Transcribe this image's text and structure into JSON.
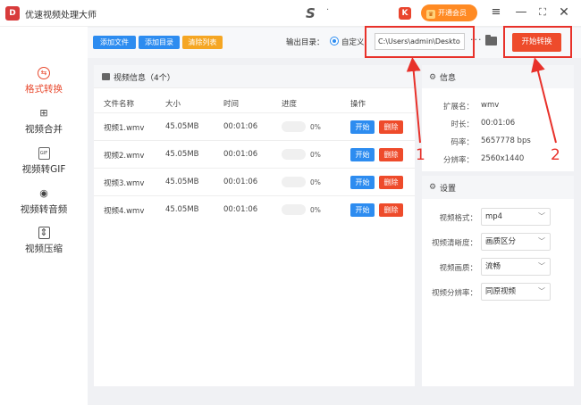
{
  "app": {
    "title": "优速视频处理大师",
    "logo_char": "D"
  },
  "titlebar": {
    "mid_logo": "S",
    "mid_dot": "·",
    "k_icon": "K",
    "vip_label": "开通会员",
    "vip_crown": "♛"
  },
  "sidebar": {
    "items": [
      {
        "label": "格式转换",
        "icon": "format-convert-icon",
        "glyph": "⇆",
        "active": true
      },
      {
        "label": "视频合并",
        "icon": "merge-icon",
        "glyph": "⊞"
      },
      {
        "label": "视频转GIF",
        "icon": "gif-icon",
        "glyph": "GIF"
      },
      {
        "label": "视频转音频",
        "icon": "audio-icon",
        "glyph": "◉"
      },
      {
        "label": "视频压缩",
        "icon": "compress-icon",
        "glyph": "⇕"
      }
    ]
  },
  "toolbar": {
    "add_file": "添加文件",
    "add_dir": "添加目录",
    "clear_list": "清除列表",
    "output_label": "输出目录：",
    "custom_label": "自定义",
    "path_value": "C:\\Users\\admin\\Deskto",
    "more": "···",
    "start_convert": "开始转换"
  },
  "annotations": {
    "num1": "1",
    "num2": "2"
  },
  "file_list": {
    "header": "视频信息（4个）",
    "columns": [
      "文件名称",
      "大小",
      "时间",
      "进度",
      "操作"
    ],
    "rows": [
      {
        "name": "视频1.wmv",
        "size": "45.05MB",
        "time": "00:01:06",
        "progress": "0%",
        "start": "开始",
        "delete": "删除"
      },
      {
        "name": "视频2.wmv",
        "size": "45.05MB",
        "time": "00:01:06",
        "progress": "0%",
        "start": "开始",
        "delete": "删除"
      },
      {
        "name": "视频3.wmv",
        "size": "45.05MB",
        "time": "00:01:06",
        "progress": "0%",
        "start": "开始",
        "delete": "删除"
      },
      {
        "name": "视频4.wmv",
        "size": "45.05MB",
        "time": "00:01:06",
        "progress": "0%",
        "start": "开始",
        "delete": "删除"
      }
    ]
  },
  "info": {
    "title": "信息",
    "fields": [
      {
        "key": "扩展名：",
        "value": "wmv"
      },
      {
        "key": "时长：",
        "value": "00:01:06"
      },
      {
        "key": "码率：",
        "value": "5657778 bps"
      },
      {
        "key": "分辨率：",
        "value": "2560x1440"
      }
    ]
  },
  "settings": {
    "title": "设置",
    "fields": [
      {
        "key": "视频格式：",
        "value": "mp4"
      },
      {
        "key": "视频清晰度：",
        "value": "画质区分"
      },
      {
        "key": "视频画质：",
        "value": "流畅"
      },
      {
        "key": "视频分辨率：",
        "value": "同原视频"
      }
    ]
  },
  "colors": {
    "accent": "#2d8cf0",
    "danger": "#ee4b2b",
    "warning": "#f5a623",
    "annotation": "#e8312a"
  }
}
